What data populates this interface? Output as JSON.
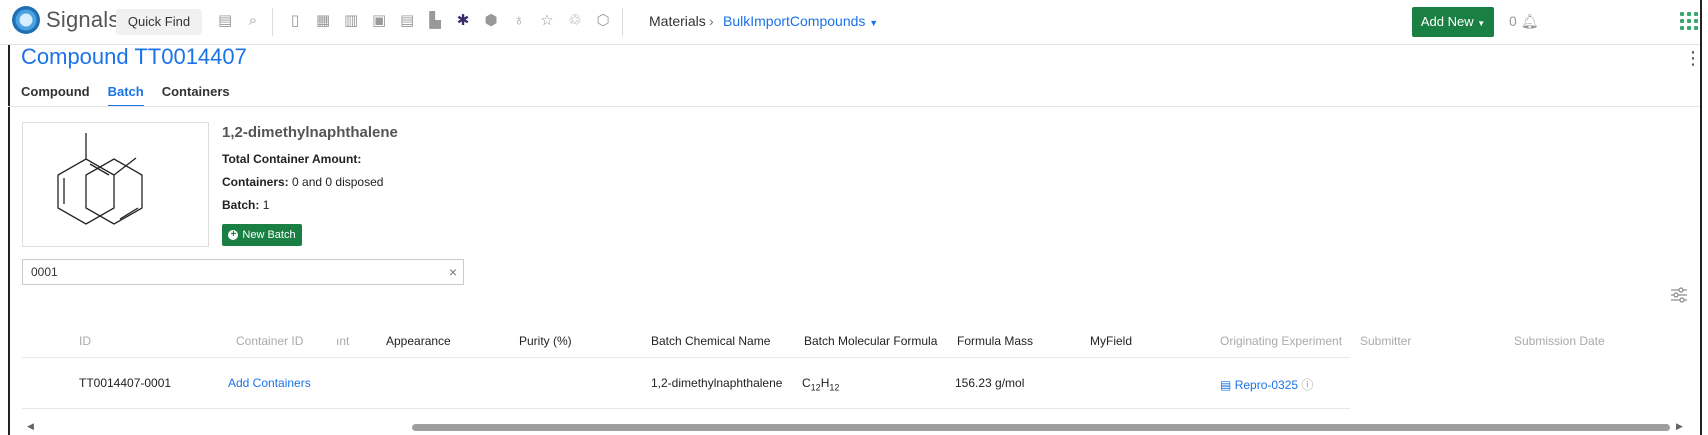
{
  "app": {
    "name": "Signals",
    "quick_find": "Quick Find",
    "add_new": "Add New",
    "notifications_count": "0",
    "accent": "#1a73e8",
    "brand_green": "#1a7f43"
  },
  "breadcrumb": {
    "root": "Materials",
    "current": "BulkImportCompounds"
  },
  "page": {
    "title": "Compound TT0014407"
  },
  "tabs": [
    {
      "label": "Compound"
    },
    {
      "label": "Batch",
      "active": true
    },
    {
      "label": "Containers"
    }
  ],
  "compound": {
    "name": "1,2-dimethylnaphthalene",
    "total_container_amount_label": "Total Container Amount:",
    "containers_label": "Containers:",
    "containers_value": "0 and 0 disposed",
    "batch_label": "Batch:",
    "batch_value": "1",
    "new_batch": "New Batch"
  },
  "search": {
    "value": "0001"
  },
  "table": {
    "headers": {
      "id": "ID",
      "container_id": "Container ID",
      "amount_partial": "ınt",
      "appearance": "Appearance",
      "purity": "Purity (%)",
      "batch_chemical_name": "Batch Chemical Name",
      "batch_molecular_formula": "Batch Molecular Formula",
      "formula_mass": "Formula Mass",
      "myfield": "MyField",
      "originating_experiment": "Originating Experiment",
      "submitter": "Submitter",
      "submission_date": "Submission Date"
    },
    "rows": [
      {
        "id": "TT0014407-0001",
        "container_action": "Add Containers",
        "batch_chemical_name": "1,2-dimethylnaphthalene",
        "formula_c": "C",
        "formula_c_sub": "12",
        "formula_h": "H",
        "formula_h_sub": "12",
        "formula_mass": "156.23 g/mol",
        "originating_experiment": "Repro-0325"
      }
    ]
  }
}
